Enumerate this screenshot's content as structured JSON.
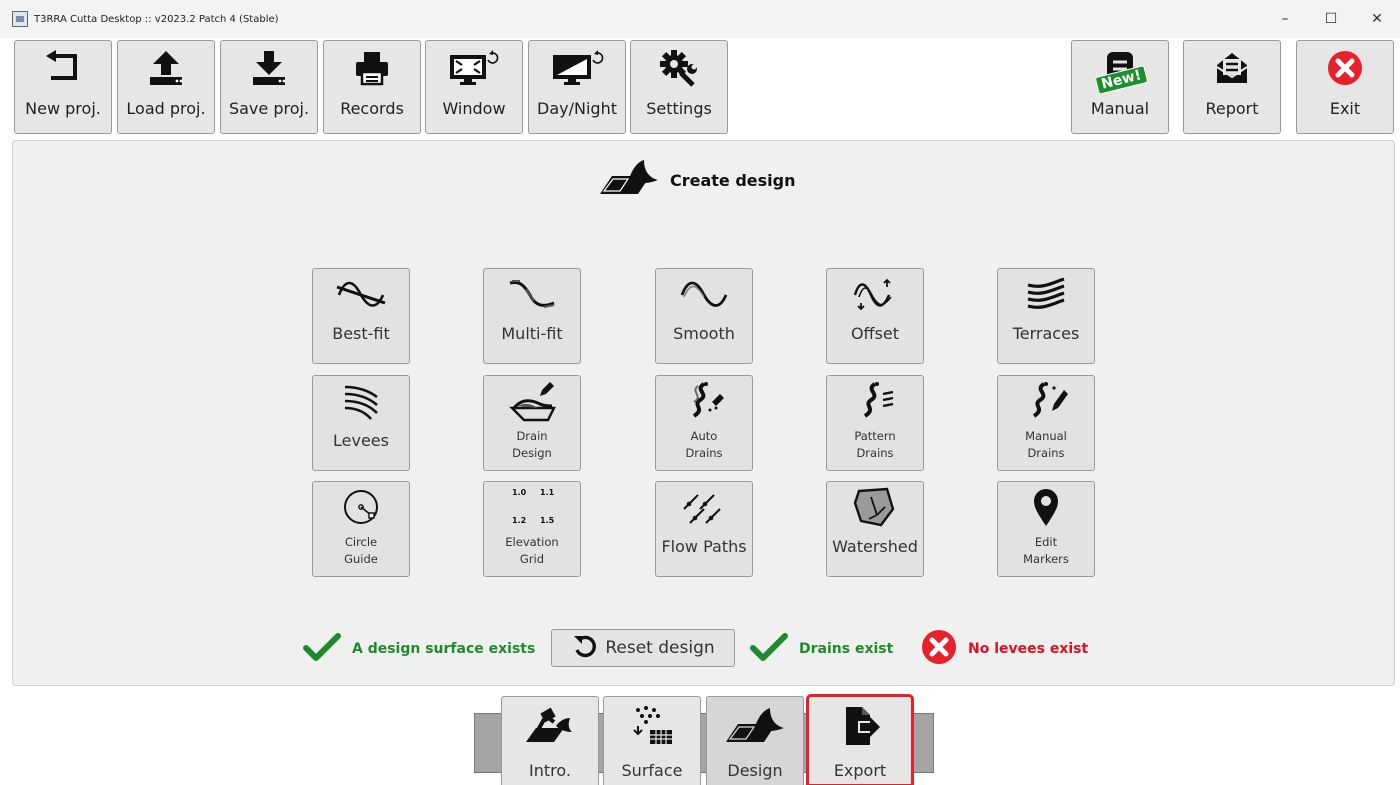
{
  "window": {
    "title": "T3RRA Cutta Desktop :: v2023.2 Patch 4 (Stable)",
    "controls": [
      "–",
      "☐",
      "✕"
    ]
  },
  "toolbar": {
    "left": [
      {
        "label": "New proj.",
        "icon": "undo-arrow-icon"
      },
      {
        "label": "Load proj.",
        "icon": "upload-icon"
      },
      {
        "label": "Save proj.",
        "icon": "download-icon"
      },
      {
        "label": "Records",
        "icon": "printer-icon"
      },
      {
        "label": "Window",
        "icon": "window-toggle-icon"
      },
      {
        "label": "Day/Night",
        "icon": "monitor-toggle-icon"
      },
      {
        "label": "Settings",
        "icon": "gear-wrench-icon"
      }
    ],
    "right": [
      {
        "label": "Manual",
        "icon": "manual-icon",
        "badge": "New!"
      },
      {
        "label": "Report",
        "icon": "report-icon"
      },
      {
        "label": "Exit",
        "icon": "exit-icon"
      }
    ]
  },
  "panel": {
    "title": "Create design"
  },
  "tools": {
    "row1": [
      {
        "label": "Best-fit",
        "icon": "best-fit-icon"
      },
      {
        "label": "Multi-fit",
        "icon": "multi-fit-icon"
      },
      {
        "label": "Smooth",
        "icon": "smooth-icon"
      },
      {
        "label": "Offset",
        "icon": "offset-icon"
      },
      {
        "label": "Terraces",
        "icon": "terraces-icon"
      }
    ],
    "row2": [
      {
        "label": "Levees",
        "icon": "levees-icon"
      },
      {
        "label": "Drain\nDesign",
        "icon": "drain-design-icon"
      },
      {
        "label": "Auto\nDrains",
        "icon": "auto-drains-icon"
      },
      {
        "label": "Pattern\nDrains",
        "icon": "pattern-drains-icon"
      },
      {
        "label": "Manual\nDrains",
        "icon": "manual-drains-icon"
      }
    ],
    "row3": [
      {
        "label": "Circle\nGuide",
        "icon": "circle-guide-icon"
      },
      {
        "label": "Elevation\nGrid",
        "icon": "elevation-grid-icon",
        "grid_values": [
          "1.0",
          "1.1",
          "1.2",
          "1.5"
        ]
      },
      {
        "label": "Flow Paths",
        "icon": "flow-paths-icon"
      },
      {
        "label": "Watershed",
        "icon": "watershed-icon"
      },
      {
        "label": "Edit\nMarkers",
        "icon": "map-marker-icon"
      }
    ]
  },
  "status": {
    "surface": "A design surface exists",
    "reset_label": "Reset design",
    "drains": "Drains exist",
    "levees": "No levees exist",
    "colors": {
      "ok": "#1f8a2c",
      "error": "#e0101e"
    }
  },
  "tabs": [
    {
      "label": "Intro.",
      "icon": "intro-icon"
    },
    {
      "label": "Surface",
      "icon": "surface-icon"
    },
    {
      "label": "Design",
      "icon": "design-icon",
      "active": true
    },
    {
      "label": "Export",
      "icon": "export-icon",
      "highlighted": true
    }
  ]
}
